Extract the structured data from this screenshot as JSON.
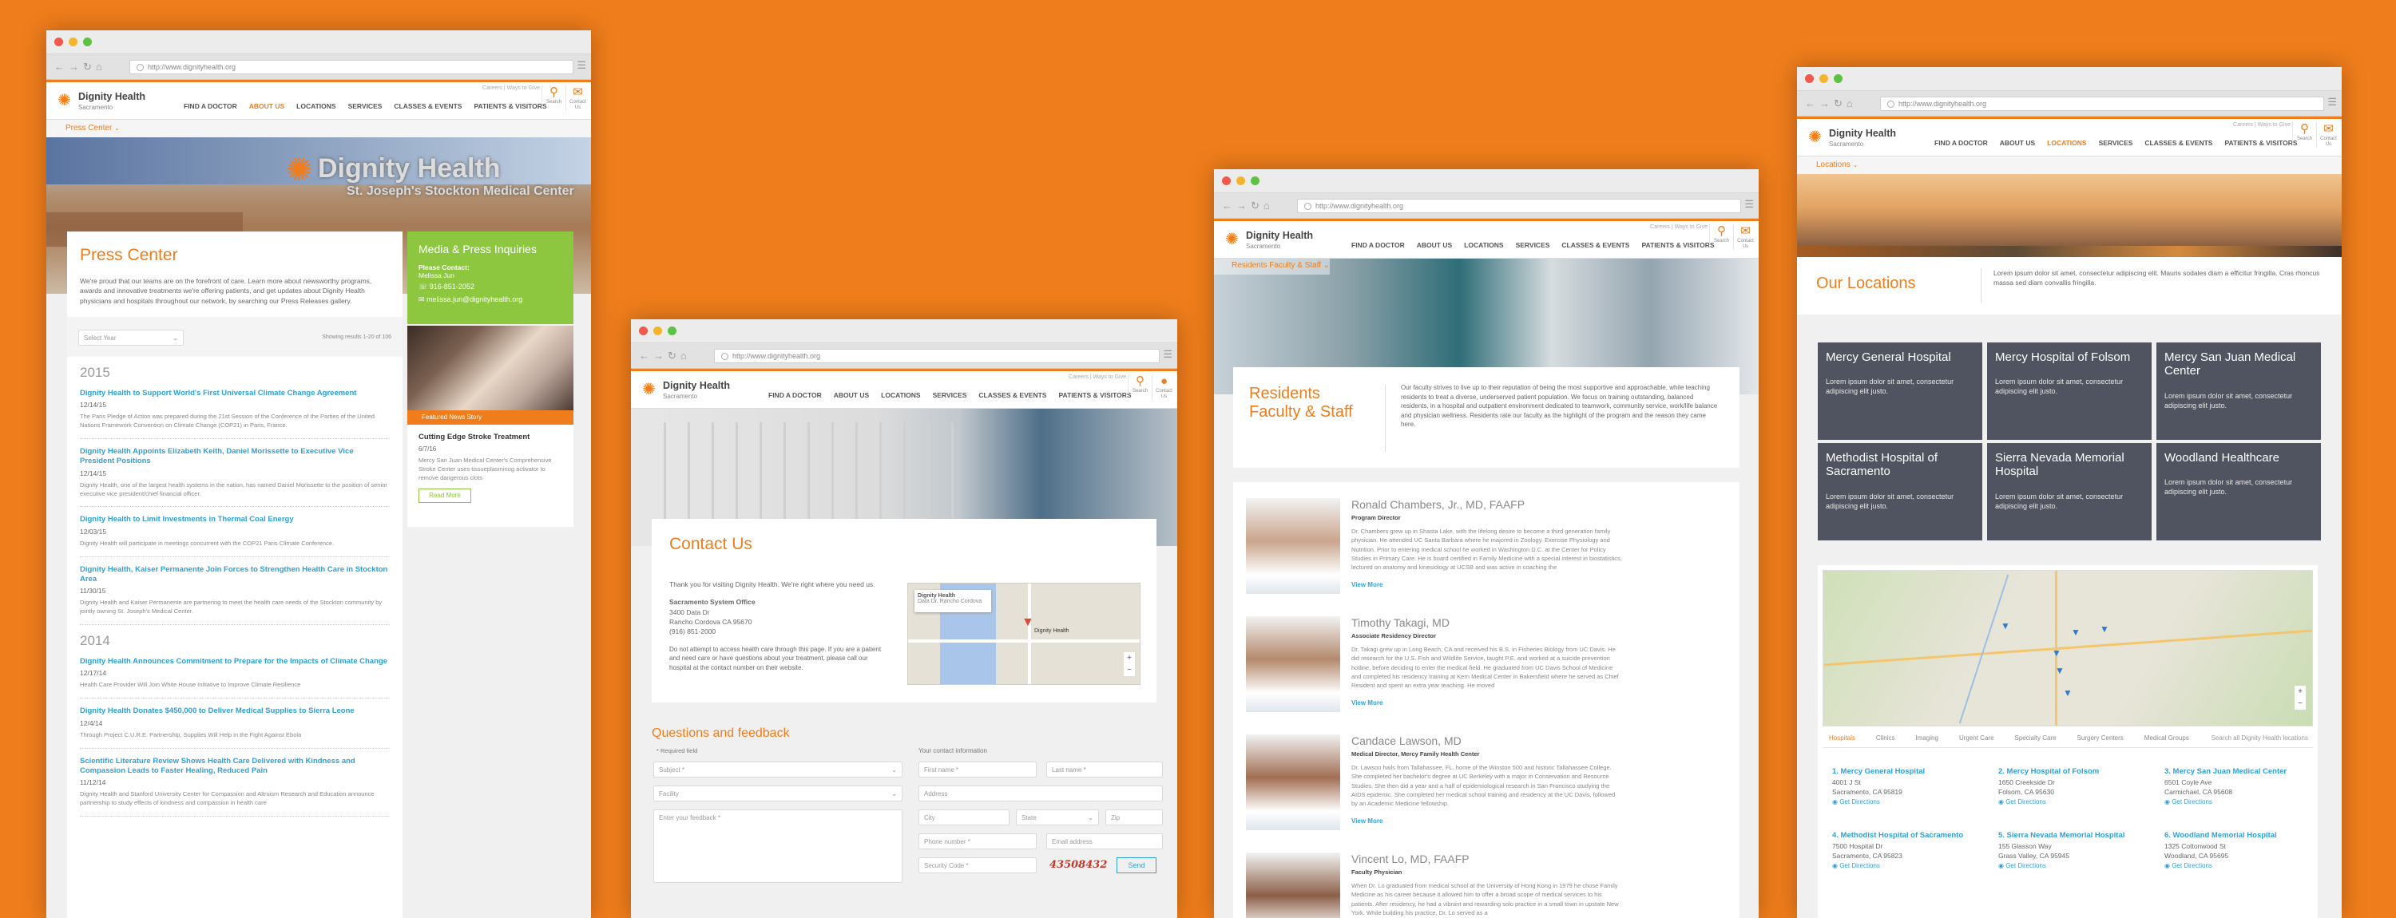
{
  "browser": {
    "url": "http://www.dignityhealth.org"
  },
  "site": {
    "logo_name": "Dignity Health",
    "logo_sub": "Sacramento",
    "nav": [
      "FIND A DOCTOR",
      "ABOUT US",
      "LOCATIONS",
      "SERVICES",
      "CLASSES & EVENTS",
      "PATIENTS & VISITORS"
    ],
    "util": "Careers  |  Ways to Give",
    "search_label": "Search",
    "contact_label": "Contact Us"
  },
  "press": {
    "sub_nav": "Press Center",
    "hero_sign": "Dignity Health",
    "hero_sign_sub": "St. Joseph's Stockton Medical Center",
    "title": "Press Center",
    "intro": "We're proud that our teams are on the forefront of care. Learn more about newsworthy programs, awards and innovative treatments we're offering patients, and get updates about Dignity Health physicians and hospitals throughout our network, by searching our Press Releases gallery.",
    "select": "Select Year",
    "showing": "Showing results 1-20 of 106",
    "media": {
      "title": "Media & Press Inquiries",
      "contact_label": "Please Contact:",
      "name": "Melissa Jun",
      "phone": "916-851-2052",
      "email": "melissa.jun@dignityhealth.org"
    },
    "featured": {
      "tag": "Featured News Story",
      "title": "Cutting Edge Stroke Treatment",
      "date": "6/7/16",
      "text": "Mercy San Juan Medical Center's Comprehensive Stroke Center uses tissueplasminog activator to remove dangerous clots",
      "button": "Read More"
    },
    "years": [
      {
        "year": "2015",
        "items": [
          {
            "title": "Dignity Health to Support World's First Universal Climate Change Agreement",
            "date": "12/14/15",
            "excerpt": "The Paris Pledge of Action was prepared during the 21st Session of the Conference of the Parties of the United Nations Framework Convention on Climate Change (COP21) in Paris, France."
          },
          {
            "title": "Dignity Health Appoints Elizabeth Keith, Daniel Morissette to Executive Vice President Positions",
            "date": "12/14/15",
            "excerpt": "Dignity Health, one of the largest health systems in the nation, has named Daniel Morissette to the position of senior executive vice president/chief financial officer."
          },
          {
            "title": "Dignity Health to Limit Investments in Thermal Coal Energy",
            "date": "12/03/15",
            "excerpt": "Dignity Health will participate in meetings concurrent with the COP21 Paris Climate Conference."
          },
          {
            "title": "Dignity Health, Kaiser Permanente Join Forces to Strengthen Health Care in Stockton Area",
            "date": "11/30/15",
            "excerpt": "Dignity Health and Kaiser Permanente are partnering to meet the health care needs of the Stockton community by jointly owning St. Joseph's Medical Center."
          }
        ]
      },
      {
        "year": "2014",
        "items": [
          {
            "title": "Dignity Health Announces Commitment to Prepare for the Impacts of Climate Change",
            "date": "12/17/14",
            "excerpt": "Health Care Provider Will Join White House Initiative to Improve Climate Resilience"
          },
          {
            "title": "Dignity Health Donates $450,000 to Deliver Medical Supplies to Sierra Leone",
            "date": "12/4/14",
            "excerpt": "Through Project C.U.R.E. Partnership, Supplies Will Help in the Fight Against Ebola"
          },
          {
            "title": "Scientific Literature Review Shows Health Care Delivered with Kindness and Compassion Leads to Faster Healing, Reduced Pain",
            "date": "11/12/14",
            "excerpt": "Dignity Health and Stanford University Center for Compassion and Altruism Research and Education announce partnership to study effects of kindness and compassion in health care"
          }
        ]
      }
    ]
  },
  "contact": {
    "title": "Contact Us",
    "intro": "Thank you for visiting Dignity Health. We're right where you need us.",
    "office": "Sacramento System Office",
    "addr1": "3400 Data Dr",
    "addr2": "Rancho Cordova CA 95670",
    "phone": "(916) 851-2000",
    "note": "Do not attempt to access health care through this page. If you are a patient and need care or have questions about your treatment, please call our hospital at the contact number on their website.",
    "map_pin": "Dignity Health",
    "map_place": "Dignity Health",
    "map_place_sub": "Data Dr, Rancho Cordova",
    "qf_title": "Questions and feedback",
    "required": "* Required field",
    "your_info": "Your contact information",
    "subject": "Subject *",
    "facility": "Facility",
    "feedback": "Enter your feedback *",
    "first": "First name *",
    "last": "Last name *",
    "address": "Address",
    "city": "City",
    "state": "State",
    "zip": "Zip",
    "phone_ph": "Phone number *",
    "email_ph": "Email address",
    "code_ph": "Security Code *",
    "captcha": "43508432",
    "send": "Send"
  },
  "faculty": {
    "sub_nav": "Residents Faculty & Staff",
    "title": "Residents Faculty & Staff",
    "intro": "Our faculty strives to live up to their reputation of being the most supportive and approachable, while teaching residents to treat a diverse, underserved patient population. We focus on training outstanding, balanced residents, in a hospital and outpatient environment dedicated to teamwork, community service, work/life balance and physician wellness. Residents rate our faculty as the highlight of the program and the reason they came here.",
    "people": [
      {
        "name": "Ronald Chambers, Jr., MD, FAAFP",
        "role": "Program Director",
        "bio": "Dr. Chambers grew up in Shasta Lake, with the lifelong desire to become a third generation family physician. He attended UC Santa Barbara where he majored in Zoology. Exercise Physiology and Nutrition. Prior to entering medical school he worked in Washington D.C. at the Center for Policy Studies in Primary Care. He is board certified in Family Medicine with a special interest in biostatistics, lectured on anatomy and kinesiology at UCSB and was active in coaching the",
        "more": "View More"
      },
      {
        "name": "Timothy Takagi, MD",
        "role": "Associate Residency Director",
        "bio": "Dr. Takagi grew up in Long Beach, CA and received his B.S. in Fisheries Biology from UC Davis. He did research for the U.S. Fish and Wildlife Service, taught P.E. and worked at a suicide prevention hotline, before deciding to enter the medical field. He graduated from UC Davis School of Medicine and completed his residency training at Kern Medical Center in Bakersfield where he served as Chief Resident and spent an extra year teaching. He moved",
        "more": "View More"
      },
      {
        "name": "Candace Lawson, MD",
        "role": "Medical Director, Mercy Family Health Center",
        "bio": "Dr. Lawson hails from Tallahassee, FL, home of the Winston 500 and historic Tallahassee College. She completed her bachelor's degree at UC Berkeley with a major in Conservation and Resource Studies. She then did a year and a half of epidemiological research in San Francisco studying the AIDS epidemic. She completed her medical school training and residency at the UC Davis, followed by an Academic Medicine fellowship.",
        "more": "View More"
      },
      {
        "name": "Vincent Lo, MD, FAAFP",
        "role": "Faculty Physician",
        "bio": "When Dr. Lo graduated from medical school at the University of Hong Kong in 1979 he chose Family Medicine as his career because it allowed him to offer a broad scope of medical services to his patients. After residency, he had a vibrant and rewarding solo practice in a small town in upstate New York. While building his practice, Dr. Lo served as a"
      }
    ]
  },
  "locations": {
    "sub_nav": "Locations",
    "title": "Our Locations",
    "intro": "Lorem ipsum dolor sit amet, consectetur adipiscing elit. Mauris sodales diam a efficitur fringilla. Cras rhoncus massa sed diam convallis fringilla.",
    "hospitals": [
      {
        "name": "Mercy General Hospital",
        "text": "Lorem ipsum dolor sit amet, consectetur adipiscing elit justo."
      },
      {
        "name": "Mercy Hospital of Folsom",
        "text": "Lorem ipsum dolor sit amet, consectetur adipiscing elit justo."
      },
      {
        "name": "Mercy San Juan Medical Center",
        "text": "Lorem ipsum dolor sit amet, consectetur adipiscing elit justo."
      },
      {
        "name": "Methodist Hospital of Sacramento",
        "text": "Lorem ipsum dolor sit amet, consectetur adipiscing elit justo."
      },
      {
        "name": "Sierra Nevada Memorial Hospital",
        "text": "Lorem ipsum dolor sit amet, consectetur adipiscing elit justo."
      },
      {
        "name": "Woodland Healthcare",
        "text": "Lorem ipsum dolor sit amet, consectetur adipiscing elit justo."
      }
    ],
    "filters": [
      "Hospitals",
      "Clinics",
      "Imaging",
      "Urgent Care",
      "Specialty Care",
      "Surgery Centers",
      "Medical Groups"
    ],
    "search": "Search all Dignity Health locations",
    "list": [
      {
        "n": "1. Mercy General Hospital",
        "a1": "4001 J St",
        "a2": "Sacramento, CA 95819",
        "d": "Get Directions"
      },
      {
        "n": "2. Mercy Hospital of Folsom",
        "a1": "1650 Creekside Dr",
        "a2": "Folsom, CA 95630",
        "d": "Get Directions"
      },
      {
        "n": "3. Mercy San Juan Medical Center",
        "a1": "6501 Coyle Ave",
        "a2": "Carmichael, CA 95608",
        "d": "Get Directions"
      },
      {
        "n": "4. Methodist Hospital of Sacramento",
        "a1": "7500 Hospital Dr",
        "a2": "Sacramento, CA 95823",
        "d": "Get Directions"
      },
      {
        "n": "5. Sierra Nevada Memorial Hospital",
        "a1": "155 Glasson Way",
        "a2": "Grass Valley, CA 95945",
        "d": "Get Directions"
      },
      {
        "n": "6. Woodland Memorial Hospital",
        "a1": "1325 Cottonwood St",
        "a2": "Woodland, CA 95695",
        "d": "Get Directions"
      }
    ]
  }
}
